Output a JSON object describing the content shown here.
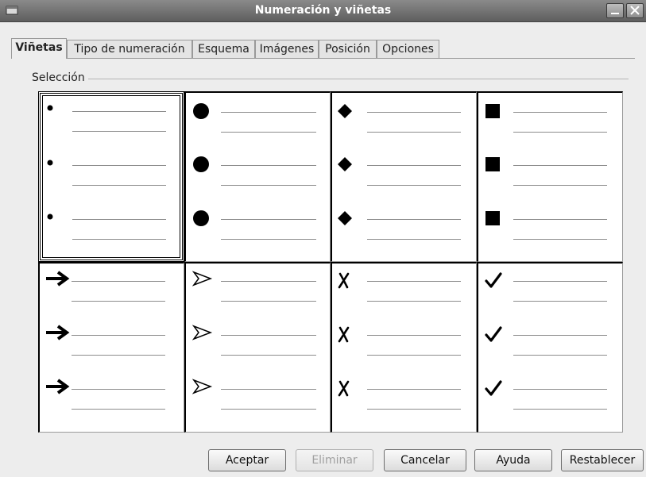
{
  "window": {
    "title": "Numeración y viñetas"
  },
  "tabs": [
    {
      "label": "Viñetas",
      "active": true
    },
    {
      "label": "Tipo de numeración",
      "active": false
    },
    {
      "label": "Esquema",
      "active": false
    },
    {
      "label": "Imágenes",
      "active": false
    },
    {
      "label": "Posición",
      "active": false
    },
    {
      "label": "Opciones",
      "active": false
    }
  ],
  "selection": {
    "label": "Selección",
    "options": [
      {
        "bullet": "small-dot",
        "selected": true
      },
      {
        "bullet": "large-dot",
        "selected": false
      },
      {
        "bullet": "diamond",
        "selected": false
      },
      {
        "bullet": "square",
        "selected": false
      },
      {
        "bullet": "bold-arrow",
        "selected": false
      },
      {
        "bullet": "outline-arrowhead",
        "selected": false
      },
      {
        "bullet": "x-mark",
        "selected": false
      },
      {
        "bullet": "check-mark",
        "selected": false
      }
    ]
  },
  "buttons": {
    "ok": "Aceptar",
    "delete": "Eliminar",
    "cancel": "Cancelar",
    "help": "Ayuda",
    "reset": "Restablecer"
  }
}
